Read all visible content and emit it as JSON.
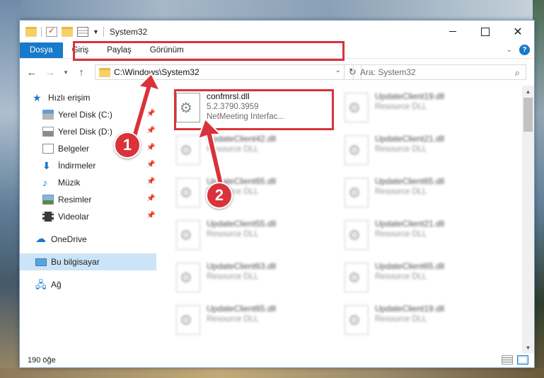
{
  "window": {
    "title": "System32"
  },
  "ribbon": {
    "tabs": [
      "Dosya",
      "Giriş",
      "Paylaş",
      "Görünüm"
    ]
  },
  "address": {
    "path": "C:\\Windows\\System32",
    "search_placeholder": "Ara: System32"
  },
  "sidebar": {
    "quick_access": "Hızlı erişim",
    "items": [
      {
        "label": "Yerel Disk (C:)",
        "pinned": true,
        "icon": "disk-icon"
      },
      {
        "label": "Yerel Disk (D:)",
        "pinned": true,
        "icon": "disk-icon"
      },
      {
        "label": "Belgeler",
        "pinned": true,
        "icon": "documents-icon"
      },
      {
        "label": "İndirmeler",
        "pinned": true,
        "icon": "downloads-icon"
      },
      {
        "label": "Müzik",
        "pinned": true,
        "icon": "music-icon"
      },
      {
        "label": "Resimler",
        "pinned": true,
        "icon": "pictures-icon"
      },
      {
        "label": "Videolar",
        "pinned": true,
        "icon": "videos-icon"
      }
    ],
    "onedrive": "OneDrive",
    "this_pc": "Bu bilgisayar",
    "network": "Ağ"
  },
  "files": {
    "highlighted": {
      "name": "confmrsl.dll",
      "version": "5.2.3790.3959",
      "description": "NetMeeting Interfac..."
    },
    "blurred": [
      {
        "name": "UpdateClient19.dll",
        "type": "Resource DLL"
      },
      {
        "name": "UpdateClient42.dll",
        "type": "Resource DLL"
      },
      {
        "name": "UpdateClient21.dll",
        "type": "Resource DLL"
      },
      {
        "name": "UpdateClient65.dll",
        "type": "Resource DLL"
      },
      {
        "name": "UpdateClient65.dll",
        "type": "Resource DLL"
      },
      {
        "name": "UpdateClient55.dll",
        "type": "Resource DLL"
      },
      {
        "name": "UpdateClient21.dll",
        "type": "Resource DLL"
      },
      {
        "name": "UpdateClient63.dll",
        "type": "Resource DLL"
      },
      {
        "name": "UpdateClient65.dll",
        "type": "Resource DLL"
      },
      {
        "name": "UpdateClient65.dll",
        "type": "Resource DLL"
      },
      {
        "name": "UpdateClient19.dll",
        "type": "Resource DLL"
      }
    ]
  },
  "status": {
    "count": "190 öğe"
  },
  "annotations": {
    "step1": "1",
    "step2": "2"
  },
  "colors": {
    "accent": "#1979ca",
    "highlight_red": "#d9323a",
    "selected_bg": "#cce4f7"
  }
}
